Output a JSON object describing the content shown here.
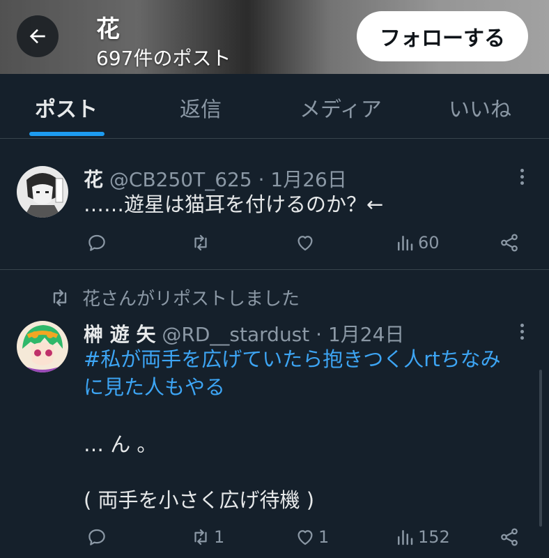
{
  "header": {
    "name": "花",
    "post_count": "697件のポスト",
    "follow_label": "フォローする"
  },
  "tabs": [
    {
      "label": "ポスト",
      "active": true
    },
    {
      "label": "返信",
      "active": false
    },
    {
      "label": "メディア",
      "active": false
    },
    {
      "label": "いいね",
      "active": false
    }
  ],
  "tweets": [
    {
      "name": "花",
      "handle": "@CB250T_625",
      "sep": "·",
      "date": "1月26日",
      "text": "……遊星は猫耳を付けるのか？←",
      "replies": "",
      "reposts": "",
      "likes": "",
      "views": "60"
    },
    {
      "repost_note": "花さんがリポストしました",
      "name": "榊 遊 矢",
      "handle": "@RD__stardust",
      "sep": "·",
      "date": "1月24日",
      "link_line1": "#私が両手を広げていたら抱きつく人rtちなみ",
      "link_line2": "に見た人もやる",
      "text_line3": "… ん 。",
      "text_line4": "( 両手を小さく広げ待機 )",
      "replies": "",
      "reposts": "1",
      "likes": "1",
      "views": "152"
    }
  ],
  "colors": {
    "background": "#15202b",
    "accent": "#1d9bf0",
    "link": "#3da5f4",
    "muted": "#8b98a5"
  }
}
